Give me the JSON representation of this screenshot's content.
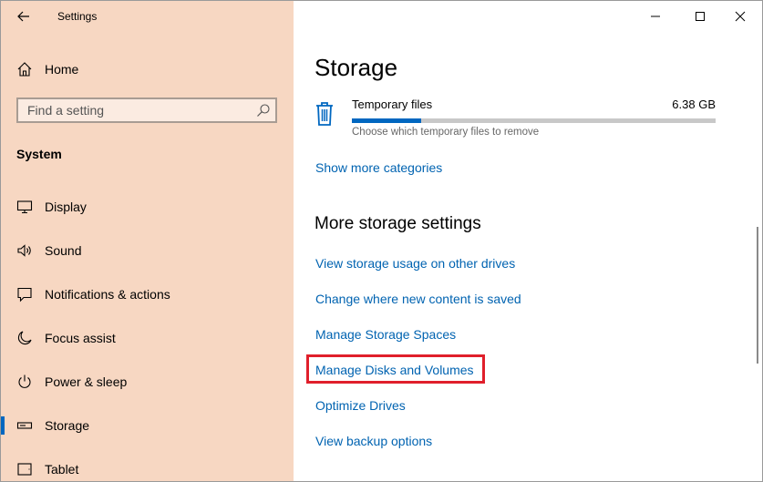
{
  "window": {
    "title": "Settings"
  },
  "sidebar": {
    "home_label": "Home",
    "search": {
      "placeholder": "Find a setting",
      "value": ""
    },
    "section_title": "System",
    "items": [
      {
        "label": "Display",
        "icon": "display-icon"
      },
      {
        "label": "Sound",
        "icon": "sound-icon"
      },
      {
        "label": "Notifications & actions",
        "icon": "notifications-icon"
      },
      {
        "label": "Focus assist",
        "icon": "moon-icon"
      },
      {
        "label": "Power & sleep",
        "icon": "power-icon"
      },
      {
        "label": "Storage",
        "icon": "storage-icon",
        "selected": true
      },
      {
        "label": "Tablet",
        "icon": "tablet-icon"
      }
    ]
  },
  "main": {
    "title": "Storage",
    "temporary_files": {
      "name": "Temporary files",
      "size": "6.38 GB",
      "description": "Choose which temporary files to remove",
      "usage_fraction": 0.19
    },
    "show_more": "Show more categories",
    "more_settings_heading": "More storage settings",
    "links": [
      "View storage usage on other drives",
      "Change where new content is saved",
      "Manage Storage Spaces",
      "Manage Disks and Volumes",
      "Optimize Drives",
      "View backup options"
    ]
  },
  "colors": {
    "sidebar_bg": "#f7d7c2",
    "accent": "#0067c0",
    "link": "#0063b1",
    "highlight": "#e01f2b"
  }
}
